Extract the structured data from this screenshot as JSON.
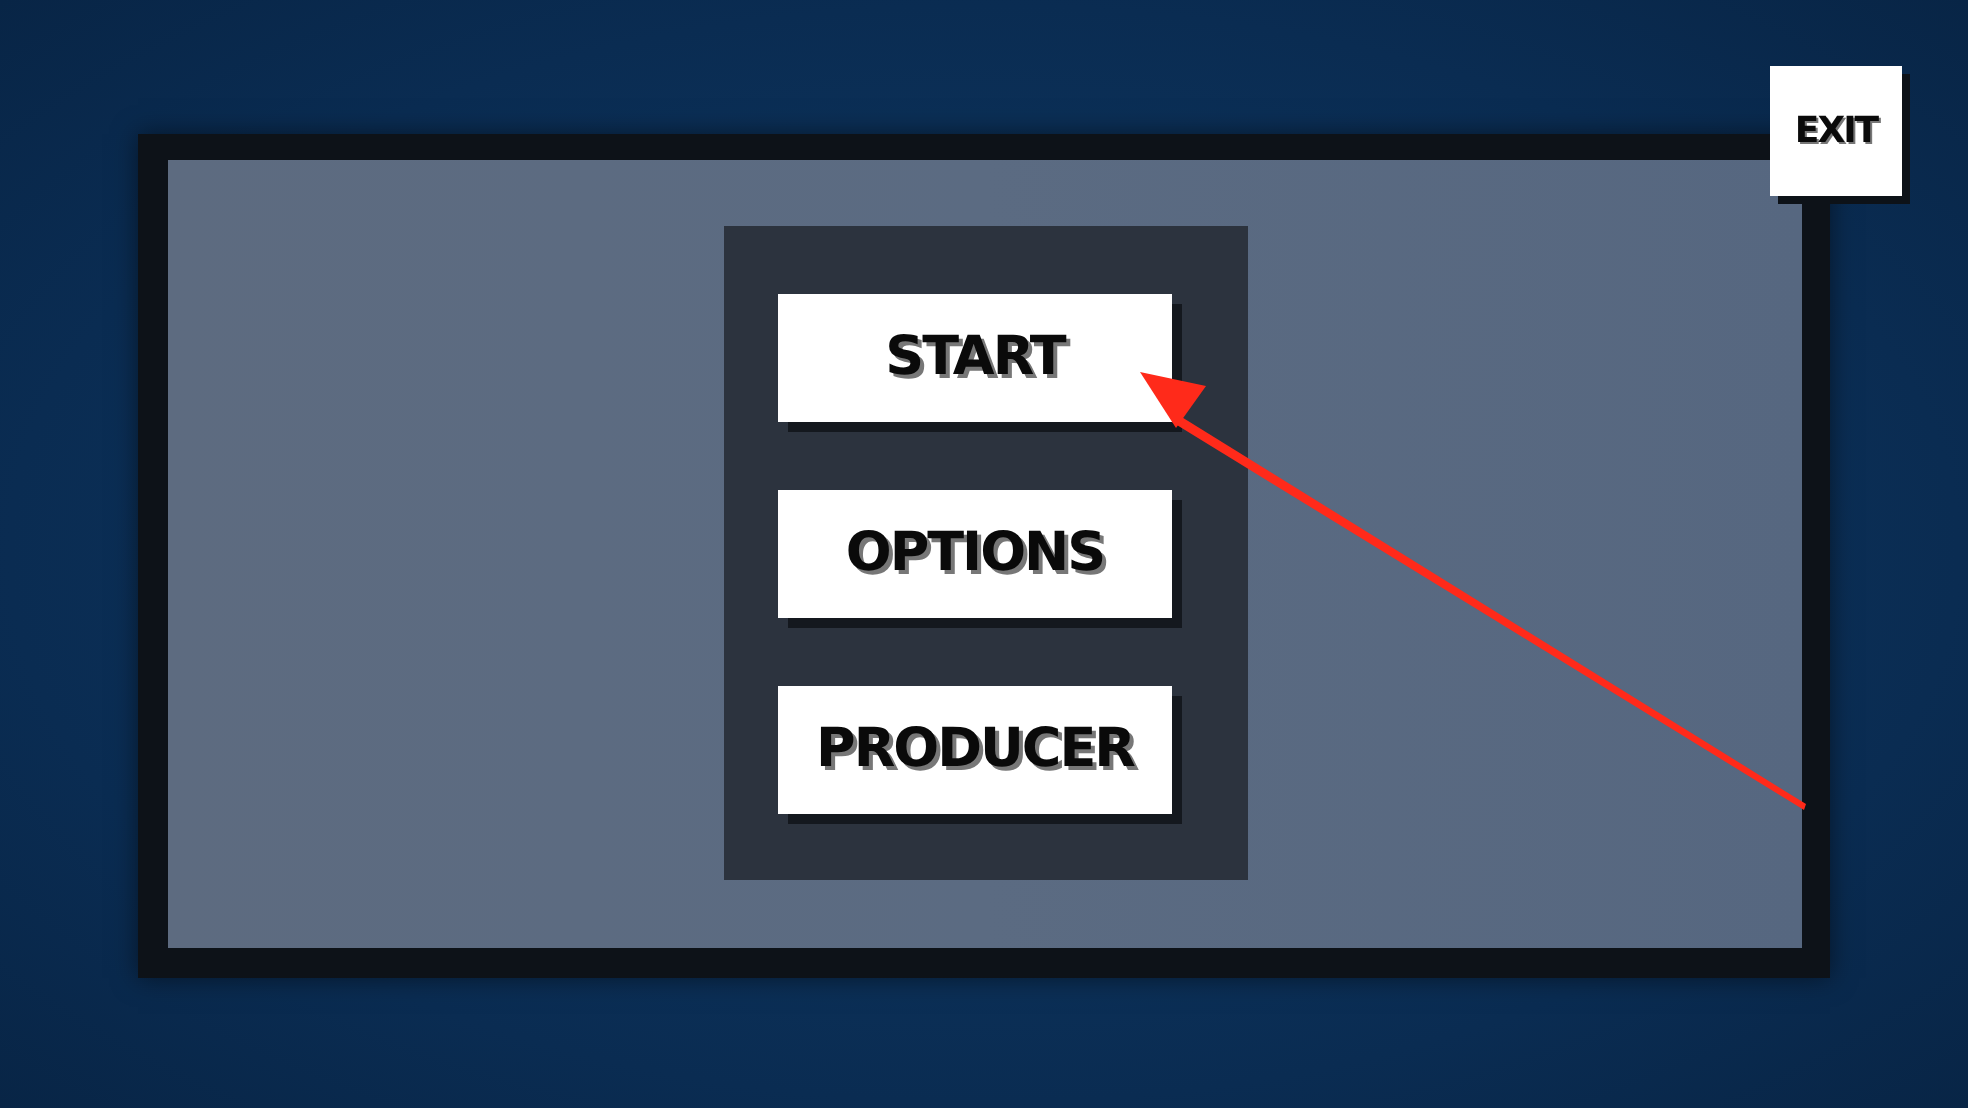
{
  "exit_button": {
    "label": "EXIT"
  },
  "menu": {
    "buttons": [
      {
        "label": "START"
      },
      {
        "label": "OPTIONS"
      },
      {
        "label": "PRODUCER"
      }
    ]
  }
}
